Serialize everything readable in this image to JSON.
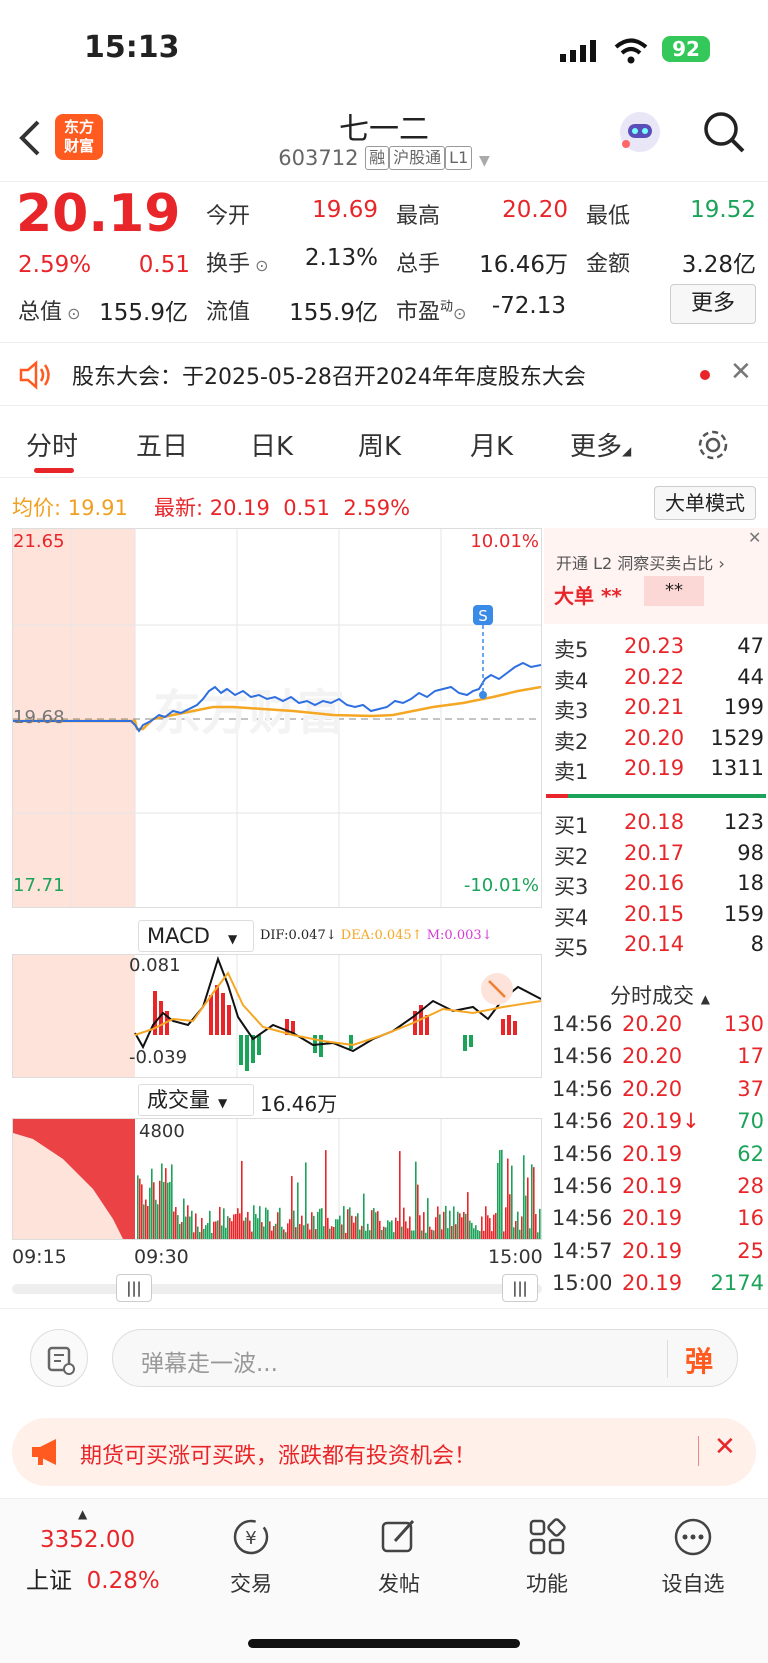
{
  "status": {
    "time": "15:13",
    "battery": "92"
  },
  "header": {
    "logo_line1": "东方",
    "logo_line2": "财富",
    "title": "七一二",
    "code": "603712",
    "tag1": "融",
    "tag2": "沪股通",
    "tag3": "L1"
  },
  "quote": {
    "price": "20.19",
    "pct": "2.59%",
    "chg": "0.51",
    "open_label": "今开",
    "open": "19.69",
    "high_label": "最高",
    "high": "20.20",
    "low_label": "最低",
    "low": "19.52",
    "turnover_label": "换手",
    "turnover": "2.13%",
    "volume_label": "总手",
    "volume": "16.46万",
    "amount_label": "金额",
    "amount": "3.28亿",
    "mcap_label": "总值",
    "mcap": "155.9亿",
    "float_label": "流值",
    "float": "155.9亿",
    "pe_label": "市盈",
    "pe_sup": "动",
    "pe": "-72.13",
    "more_button": "更多"
  },
  "notice": {
    "text": "股东大会：于2025-05-28召开2024年年度股东大会"
  },
  "tabs": [
    "分时",
    "五日",
    "日K",
    "周K",
    "月K",
    "更多"
  ],
  "infobar": {
    "avg_label": "均价:",
    "avg": "19.91",
    "latest_label": "最新:",
    "latest": "20.19",
    "chg": "0.51",
    "pct": "2.59%",
    "mode_button": "大单模式"
  },
  "chart": {
    "ymax": "21.65",
    "ymid": "19.68",
    "ymin": "17.71",
    "pmax": "10.01%",
    "pmin": "-10.01%",
    "macd_label": "MACD",
    "dif": "DIF:0.047",
    "dea": "DEA:0.045",
    "m": "M:0.003",
    "macd_top": "0.081",
    "macd_bottom": "-0.039",
    "vol_label": "成交量",
    "vol_total": "16.46万",
    "vol_top": "4800",
    "t_start": "09:15",
    "t_open": "09:30",
    "t_end": "15:00",
    "s_marker": "S",
    "watermark": "东方财富"
  },
  "side": {
    "l2_text": "开通 L2 洞察买卖占比",
    "big_label": "大单",
    "big_val1": "**",
    "big_val2": "**",
    "asks": [
      {
        "label": "卖5",
        "price": "20.23",
        "qty": "47"
      },
      {
        "label": "卖4",
        "price": "20.22",
        "qty": "44"
      },
      {
        "label": "卖3",
        "price": "20.21",
        "qty": "199"
      },
      {
        "label": "卖2",
        "price": "20.20",
        "qty": "1529"
      },
      {
        "label": "卖1",
        "price": "20.19",
        "qty": "1311"
      }
    ],
    "bids": [
      {
        "label": "买1",
        "price": "20.18",
        "qty": "123"
      },
      {
        "label": "买2",
        "price": "20.17",
        "qty": "98"
      },
      {
        "label": "买3",
        "price": "20.16",
        "qty": "18"
      },
      {
        "label": "买4",
        "price": "20.15",
        "qty": "159"
      },
      {
        "label": "买5",
        "price": "20.14",
        "qty": "8"
      }
    ],
    "ticks_title": "分时成交",
    "ticks": [
      {
        "time": "14:56",
        "price": "20.20",
        "qty": "130",
        "dir": "red"
      },
      {
        "time": "14:56",
        "price": "20.20",
        "qty": "17",
        "dir": "red"
      },
      {
        "time": "14:56",
        "price": "20.20",
        "qty": "37",
        "dir": "red"
      },
      {
        "time": "14:56",
        "price": "20.19↓",
        "qty": "70",
        "dir": "green"
      },
      {
        "time": "14:56",
        "price": "20.19",
        "qty": "62",
        "dir": "green"
      },
      {
        "time": "14:56",
        "price": "20.19",
        "qty": "28",
        "dir": "red"
      },
      {
        "time": "14:56",
        "price": "20.19",
        "qty": "16",
        "dir": "red"
      },
      {
        "time": "14:57",
        "price": "20.19",
        "qty": "25",
        "dir": "red"
      },
      {
        "time": "15:00",
        "price": "20.19",
        "qty": "2174",
        "dir": "green"
      }
    ]
  },
  "danmu": {
    "placeholder": "弹幕走一波...",
    "send": "弹"
  },
  "ad": {
    "text": "期货可买涨可买跌，涨跌都有投资机会！"
  },
  "bottom": {
    "index_value": "3352.00",
    "index_name": "上证",
    "index_pct": "0.28%",
    "nav": [
      "交易",
      "发帖",
      "功能",
      "设自选"
    ]
  },
  "colors": {
    "up": "#e8262a",
    "down": "#1ba35a",
    "brand": "#ff5a1f",
    "avg_line": "#f5a623"
  }
}
